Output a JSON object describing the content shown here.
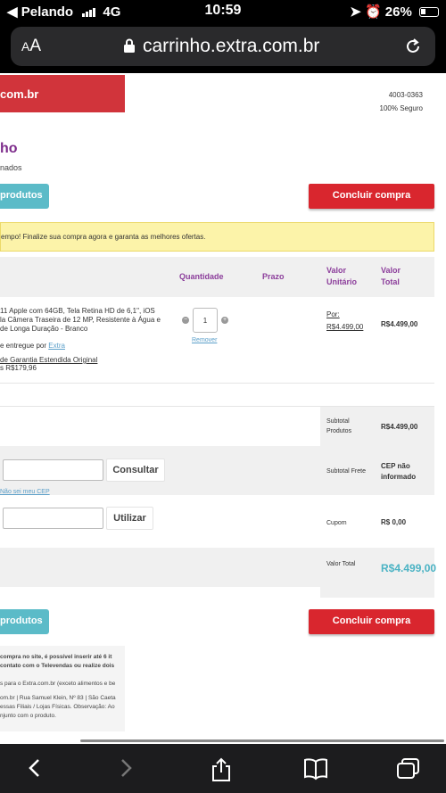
{
  "status": {
    "carrier": "Pelando",
    "network": "4G",
    "time": "10:59",
    "battery": "26%"
  },
  "browser": {
    "text_size": "AA",
    "url": "carrinho.extra.com.br"
  },
  "header": {
    "logo_fragment": "com.br",
    "phone": "4003-0363",
    "secure": "100% Seguro"
  },
  "page": {
    "title": "ho",
    "subtitle": "nados"
  },
  "buttons": {
    "continue": "produtos",
    "checkout": "Concluir compra"
  },
  "notice": "empo! Finalize sua compra agora e garanta as melhores ofertas.",
  "table": {
    "headers": {
      "quantity": "Quantidade",
      "deadline": "Prazo",
      "unit_value_1": "Valor",
      "unit_value_2": "Unitário",
      "total_1": "Valor",
      "total_2": "Total"
    }
  },
  "product": {
    "lines": [
      "11 Apple com 64GB, Tela Retina HD de 6,1\", iOS",
      "la Câmera Traseira de 12 MP, Resistente à Água e",
      "de Longa Duração - Branco"
    ],
    "delivery_prefix": "e entregue por",
    "seller": "Extra",
    "warranty": "de Garantia Estendida Original",
    "warranty_price": "s R$179,96",
    "quantity": "1",
    "remove": "Remover",
    "price_prefix": "Por:",
    "unit_price": "R$4.499,00",
    "total": "R$4.499,00"
  },
  "summary": {
    "subtotal_label_1": "Subtotal",
    "subtotal_label_2": "Produtos",
    "subtotal_value": "R$4.499,00",
    "shipping_label": "Subtotal Frete",
    "shipping_value_1": "CEP não",
    "shipping_value_2": "informado",
    "coupon_label": "Cupom",
    "coupon_value": "R$ 0,00",
    "total_label": "Valor Total",
    "total_value": "R$4.499,00"
  },
  "cep": {
    "button": "Consultar",
    "link": "Não sei meu CEP"
  },
  "coupon": {
    "button": "Utilizar"
  },
  "footer": {
    "lines": [
      "compra no site, é possível inserir até 6 it",
      "contato com o Televendas ou realize dois",
      "s para o Extra.com.br (exceto alimentos e be",
      "om.br | Rua Samuel Klein, Nº 83 | São Caeta",
      "essas Filiais / Lojas Físicas. Observação: Ao",
      "njunto com o produto."
    ]
  },
  "colors": {
    "brand_red": "#d1343b",
    "checkout_red": "#d9262e",
    "teal": "#5bbbc8",
    "purple": "#8c3e9b",
    "total_teal": "#4bb3c4"
  }
}
